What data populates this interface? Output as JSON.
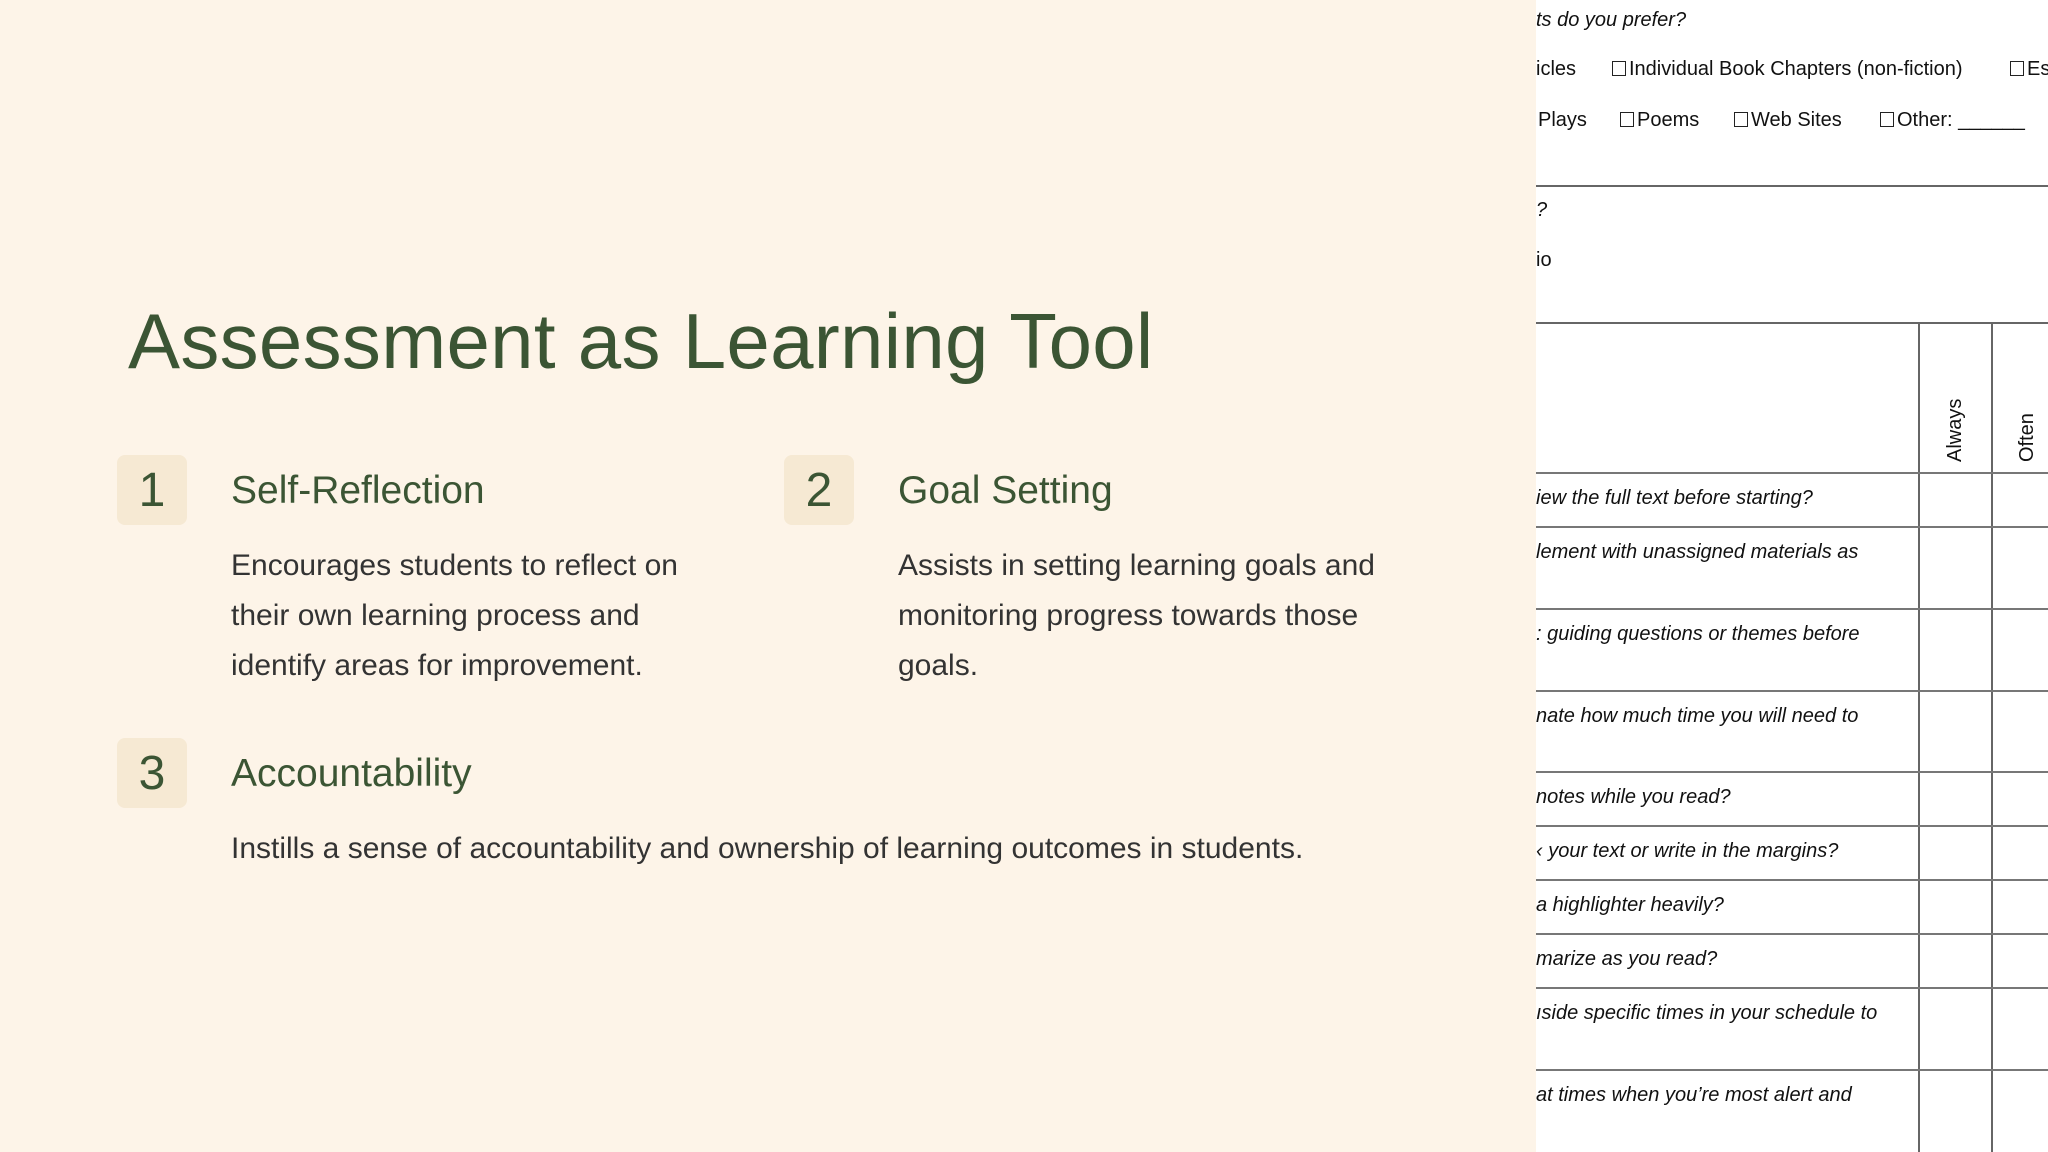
{
  "slide": {
    "title": "Assessment as Learning Tool",
    "items": [
      {
        "number": "1",
        "heading": "Self-Reflection",
        "description": "Encourages students to reflect on their own learning process and identify areas for improvement."
      },
      {
        "number": "2",
        "heading": "Goal Setting",
        "description": "Assists in setting learning goals and monitoring progress towards those goals."
      },
      {
        "number": "3",
        "heading": "Accountability",
        "description": "Instills a sense of accountability and ownership of learning outcomes in students."
      }
    ]
  },
  "form": {
    "q_top": "ts do you prefer?",
    "opt_articles": "icles",
    "opt_book": "Individual Book Chapters (non-fiction)",
    "opt_es": "Es",
    "opt_plays": "Plays",
    "opt_poems": "Poems",
    "opt_web": "Web Sites",
    "opt_other": "Other: ______",
    "q_mark": "?",
    "q_io": "io",
    "col_always": "Always",
    "col_often": "Often",
    "rows": [
      "iew the full text before starting?",
      "lement with unassigned materials as",
      ": guiding questions or themes before",
      "nate how much time you will need to",
      " notes while you read?",
      "‹ your text or write in the margins?",
      "a highlighter heavily?",
      "marize as you read?",
      "ıside specific times in your schedule to",
      " at times when you’re most alert and"
    ]
  }
}
